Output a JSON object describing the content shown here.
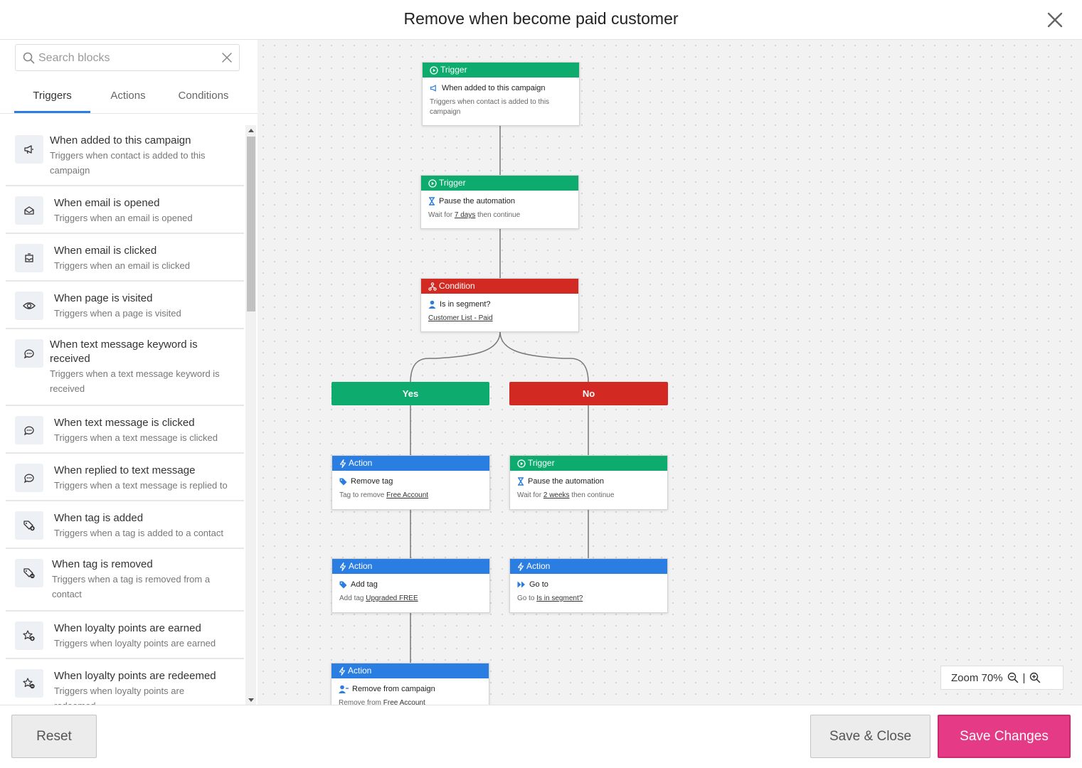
{
  "window": {
    "title": "Remove when become paid customer"
  },
  "search": {
    "placeholder": "Search blocks"
  },
  "tabs": [
    {
      "label": "Triggers",
      "active": true
    },
    {
      "label": "Actions",
      "active": false
    },
    {
      "label": "Conditions",
      "active": false
    }
  ],
  "triggers": [
    {
      "title": "When added to this campaign",
      "desc": "Triggers when contact is added to this campaign",
      "icon": "megaphone-icon"
    },
    {
      "title": "When email is opened",
      "desc": "Triggers when an email is opened",
      "icon": "envelope-open-icon"
    },
    {
      "title": "When email is clicked",
      "desc": "Triggers when an email is clicked",
      "icon": "email-click-icon"
    },
    {
      "title": "When page is visited",
      "desc": "Triggers when a page is visited",
      "icon": "eye-icon"
    },
    {
      "title": "When text message keyword is received",
      "desc": "Triggers when a text message keyword is received",
      "icon": "sms-keyword-icon"
    },
    {
      "title": "When text message is clicked",
      "desc": "Triggers when a text message is clicked",
      "icon": "sms-icon"
    },
    {
      "title": "When replied to text message",
      "desc": "Triggers when a text message is replied to",
      "icon": "sms-reply-icon"
    },
    {
      "title": "When tag is added",
      "desc": "Triggers when a tag is added to a contact",
      "icon": "tag-add-icon"
    },
    {
      "title": "When tag is removed",
      "desc": "Triggers when a tag is removed from a contact",
      "icon": "tag-remove-icon"
    },
    {
      "title": "When loyalty points are earned",
      "desc": "Triggers when loyalty points are earned",
      "icon": "star-add-icon"
    },
    {
      "title": "When loyalty points are redeemed",
      "desc": "Triggers when loyalty points are redeemed",
      "icon": "star-remove-icon"
    }
  ],
  "flow": {
    "n1": {
      "type": "Trigger",
      "title": "When added to this campaign",
      "desc": "Triggers when contact is added to this campaign"
    },
    "n2": {
      "type": "Trigger",
      "title": "Pause the automation",
      "desc_pre": "Wait for ",
      "desc_val": "7 days",
      "desc_post": " then continue"
    },
    "n3": {
      "type": "Condition",
      "title": "Is in segment?",
      "desc_val": "Customer List - Paid"
    },
    "yes": "Yes",
    "no": "No",
    "y1": {
      "type": "Action",
      "title": "Remove tag",
      "desc_pre": "Tag to remove ",
      "desc_val": "Free Account"
    },
    "y2": {
      "type": "Action",
      "title": "Add tag",
      "desc_pre": "Add tag ",
      "desc_val": "Upgraded FREE"
    },
    "y3": {
      "type": "Action",
      "title": "Remove from campaign",
      "desc_pre": "Remove from ",
      "desc_val": "Free Account"
    },
    "no1": {
      "type": "Trigger",
      "title": "Pause the automation",
      "desc_pre": "Wait for ",
      "desc_val": "2 weeks",
      "desc_post": " then continue"
    },
    "no2": {
      "type": "Action",
      "title": "Go to",
      "desc_pre": "Go to ",
      "desc_val": "Is in segment?"
    }
  },
  "zoom": {
    "label": "Zoom 70%",
    "sep": "|"
  },
  "footer": {
    "reset": "Reset",
    "save_close": "Save & Close",
    "save_changes": "Save Changes"
  },
  "colors": {
    "trigger": "#0dab6e",
    "condition": "#d22a22",
    "action": "#2a7de1",
    "primary": "#e53a86",
    "tab_active": "#2a7de1"
  }
}
